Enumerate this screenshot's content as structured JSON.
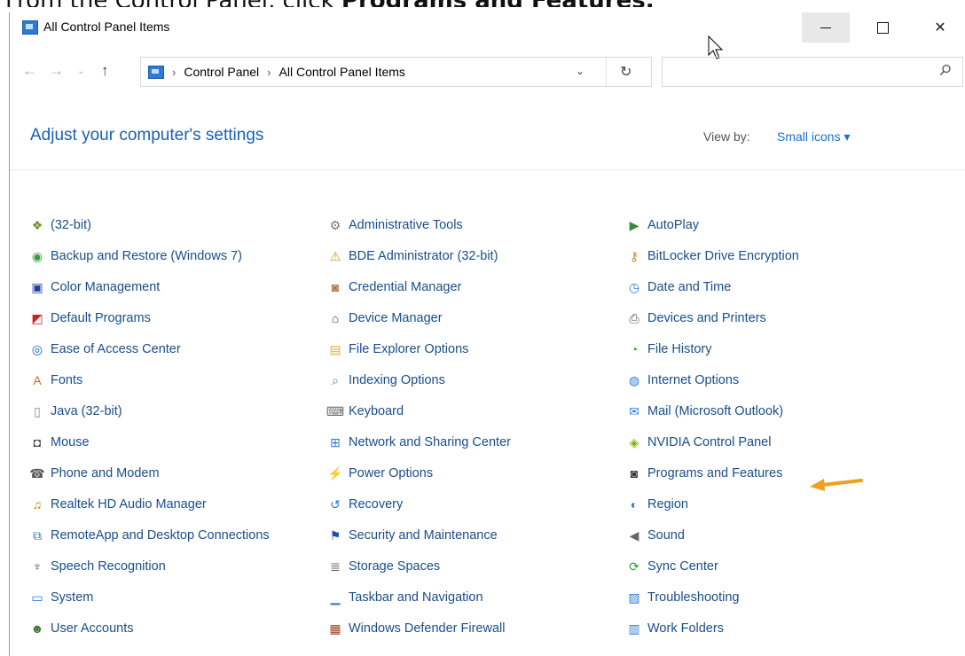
{
  "banner": {
    "prefix": "From the Control Panel, click ",
    "bold": "Programs and Features."
  },
  "window": {
    "title": "All Control Panel Items"
  },
  "address": {
    "crumbs": [
      "Control Panel",
      "All Control Panel Items"
    ],
    "search_placeholder": ""
  },
  "header": {
    "title": "Adjust your computer's settings",
    "view_by_label": "View by:",
    "view_by_value": "Small icons ▾"
  },
  "columns": [
    [
      {
        "label": "(32-bit)",
        "icon": "app-icon",
        "color": "#6b8e23"
      },
      {
        "label": "Backup and Restore (Windows 7)",
        "icon": "backup-icon",
        "color": "#3a9a3a"
      },
      {
        "label": "Color Management",
        "icon": "monitor-icon",
        "color": "#2040a0"
      },
      {
        "label": "Default Programs",
        "icon": "default-programs-icon",
        "color": "#d02020"
      },
      {
        "label": "Ease of Access Center",
        "icon": "ease-access-icon",
        "color": "#1a5fb4"
      },
      {
        "label": "Fonts",
        "icon": "fonts-icon",
        "color": "#b08000"
      },
      {
        "label": "Java (32-bit)",
        "icon": "file-icon",
        "color": "#888888"
      },
      {
        "label": "Mouse",
        "icon": "mouse-icon",
        "color": "#444444"
      },
      {
        "label": "Phone and Modem",
        "icon": "phone-icon",
        "color": "#555555"
      },
      {
        "label": "Realtek HD Audio Manager",
        "icon": "audio-icon",
        "color": "#d08000"
      },
      {
        "label": "RemoteApp and Desktop Connections",
        "icon": "remote-icon",
        "color": "#2d7bd6"
      },
      {
        "label": "Speech Recognition",
        "icon": "microphone-icon",
        "color": "#555555"
      },
      {
        "label": "System",
        "icon": "system-icon",
        "color": "#2d7bd6"
      },
      {
        "label": "User Accounts",
        "icon": "users-icon",
        "color": "#3a7a3a"
      }
    ],
    [
      {
        "label": "Administrative Tools",
        "icon": "admin-tools-icon",
        "color": "#777777"
      },
      {
        "label": "BDE Administrator (32-bit)",
        "icon": "bde-icon",
        "color": "#d0a000"
      },
      {
        "label": "Credential Manager",
        "icon": "credential-icon",
        "color": "#b07040"
      },
      {
        "label": "Device Manager",
        "icon": "device-manager-icon",
        "color": "#444444"
      },
      {
        "label": "File Explorer Options",
        "icon": "folder-options-icon",
        "color": "#e0b030"
      },
      {
        "label": "Indexing Options",
        "icon": "indexing-icon",
        "color": "#6080a0"
      },
      {
        "label": "Keyboard",
        "icon": "keyboard-icon",
        "color": "#666666"
      },
      {
        "label": "Network and Sharing Center",
        "icon": "network-icon",
        "color": "#2d7bd6"
      },
      {
        "label": "Power Options",
        "icon": "power-icon",
        "color": "#3a8a3a"
      },
      {
        "label": "Recovery",
        "icon": "recovery-icon",
        "color": "#2d7bd6"
      },
      {
        "label": "Security and Maintenance",
        "icon": "flag-icon",
        "color": "#1a4fb4"
      },
      {
        "label": "Storage Spaces",
        "icon": "storage-icon",
        "color": "#666666"
      },
      {
        "label": "Taskbar and Navigation",
        "icon": "taskbar-icon",
        "color": "#2d7bd6"
      },
      {
        "label": "Windows Defender Firewall",
        "icon": "firewall-icon",
        "color": "#a04020"
      }
    ],
    [
      {
        "label": "AutoPlay",
        "icon": "autoplay-icon",
        "color": "#3a8a3a"
      },
      {
        "label": "BitLocker Drive Encryption",
        "icon": "bitlocker-icon",
        "color": "#c09020"
      },
      {
        "label": "Date and Time",
        "icon": "clock-icon",
        "color": "#2d7bd6"
      },
      {
        "label": "Devices and Printers",
        "icon": "printer-icon",
        "color": "#555555"
      },
      {
        "label": "File History",
        "icon": "file-history-icon",
        "color": "#3a9a3a"
      },
      {
        "label": "Internet Options",
        "icon": "globe-icon",
        "color": "#2d7bd6"
      },
      {
        "label": "Mail (Microsoft Outlook)",
        "icon": "mail-icon",
        "color": "#2d7bd6"
      },
      {
        "label": "NVIDIA Control Panel",
        "icon": "nvidia-icon",
        "color": "#76b900"
      },
      {
        "label": "Programs and Features",
        "icon": "programs-icon",
        "color": "#333333"
      },
      {
        "label": "Region",
        "icon": "region-icon",
        "color": "#2d7bd6"
      },
      {
        "label": "Sound",
        "icon": "speaker-icon",
        "color": "#666666"
      },
      {
        "label": "Sync Center",
        "icon": "sync-icon",
        "color": "#3a9a3a"
      },
      {
        "label": "Troubleshooting",
        "icon": "troubleshoot-icon",
        "color": "#2d7bd6"
      },
      {
        "label": "Work Folders",
        "icon": "work-folders-icon",
        "color": "#2d7bd6"
      }
    ]
  ]
}
